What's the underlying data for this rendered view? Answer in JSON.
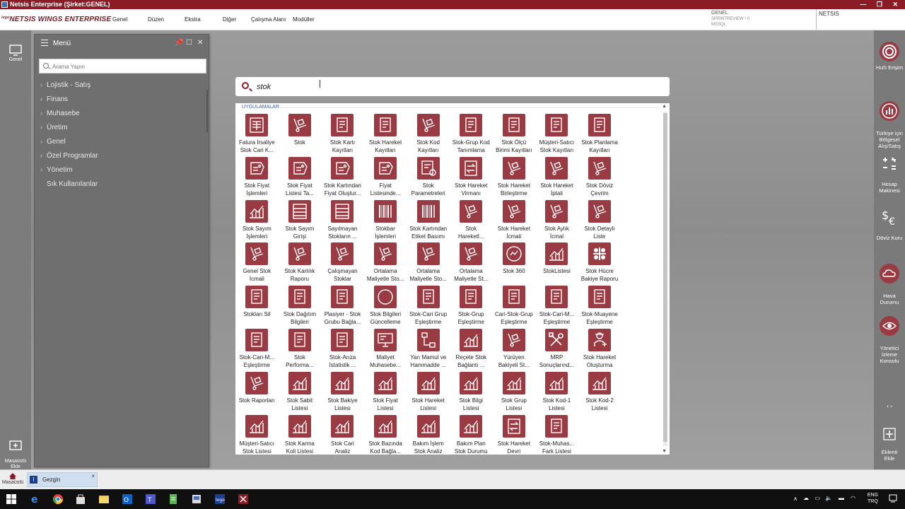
{
  "titlebar": {
    "title": "Netsis Enterprise (Şirket:GENEL)",
    "controls": "— ❐ ✕"
  },
  "header": {
    "logo_prefix": "logo",
    "logo": "NETSIS WINGS ENTERPRISE",
    "menu": [
      "Genel",
      "Düzen",
      "Ekstra",
      "Diğer",
      "Çalışma Alanı",
      "Modüller"
    ],
    "company": "GENEL",
    "server": "SPRINTREVIEW \\ 0",
    "db": "MSSQL",
    "user": "NETSIS"
  },
  "leftbar": {
    "genel": "Genel",
    "desktop_add": "Masaüstü\nEkle"
  },
  "menu_panel": {
    "title": "Menü",
    "search_placeholder": "Arama Yapın",
    "items": [
      "Lojistik - Satış",
      "Finans",
      "Muhasebe",
      "Üretim",
      "Genel",
      "Özel Programlar",
      "Yönetim"
    ],
    "favorites": "Sık Kullanılanlar"
  },
  "search": {
    "query": "stok",
    "section": "UYGULAMALAR"
  },
  "apps": [
    {
      "label": "Fatura İrsaliye\nStok Cari K...",
      "icon": "invoice-icon"
    },
    {
      "label": "Stok",
      "icon": "hand-truck-icon"
    },
    {
      "label": "Stok Kartı\nKayıtları",
      "icon": "document-icon"
    },
    {
      "label": "Stok Hareket\nKayıtları",
      "icon": "document-icon"
    },
    {
      "label": "Stok Kod\nKayıtları",
      "icon": "hand-truck-icon"
    },
    {
      "label": "Stok-Grup Kod\nTanımlama",
      "icon": "document-icon"
    },
    {
      "label": "Stok Ölçü\nBirimi Kayıtları",
      "icon": "document-icon"
    },
    {
      "label": "Müşteri-Satıcı\nStok Kayıtları",
      "icon": "document-icon"
    },
    {
      "label": "Stok Planlama\nKayıtları",
      "icon": "document-icon"
    },
    {
      "label": "Stok Fiyat\nİşlemleri",
      "icon": "price-tag-icon"
    },
    {
      "label": "Stok Fiyat\nListesi Ta...",
      "icon": "price-tag-icon"
    },
    {
      "label": "Stok Kartından\nFiyat Oluştur...",
      "icon": "price-tag-icon"
    },
    {
      "label": "Fiyat\nListesinde...",
      "icon": "price-tag-icon"
    },
    {
      "label": "Stok\nParametreleri",
      "icon": "settings-document-icon"
    },
    {
      "label": "Stok Hareket\nVirmanı",
      "icon": "transfer-icon"
    },
    {
      "label": "Stok Hareket\nBirleştirme",
      "icon": "hand-truck-icon"
    },
    {
      "label": "Stok Hareket\nİptali",
      "icon": "hand-truck-icon"
    },
    {
      "label": "Stok Döviz\nÇevrim",
      "icon": "hand-truck-icon"
    },
    {
      "label": "Stok Sayım\nİşlemleri",
      "icon": "chart-icon"
    },
    {
      "label": "Stok Sayım\nGirişi",
      "icon": "abacus-icon"
    },
    {
      "label": "Sayılmayan\nStokların ...",
      "icon": "abacus-icon"
    },
    {
      "label": "Stokbar\nİşlemleri",
      "icon": "barcode-icon"
    },
    {
      "label": "Stok Kartından\nEtiket Basımı",
      "icon": "barcode-icon"
    },
    {
      "label": "Stok\nHareketl...",
      "icon": "hand-truck-icon"
    },
    {
      "label": "Stok Hareket\nİcmali",
      "icon": "hand-truck-icon"
    },
    {
      "label": "Stok Aylık\nİcmal",
      "icon": "hand-truck-icon"
    },
    {
      "label": "Stok Detaylı\nListe",
      "icon": "hand-truck-icon"
    },
    {
      "label": "Genel Stok\nİcmali",
      "icon": "hand-truck-icon"
    },
    {
      "label": "Stok Karlılık\nRaporu",
      "icon": "hand-truck-icon"
    },
    {
      "label": "Çalışmayan\nStoklar",
      "icon": "hand-truck-icon"
    },
    {
      "label": "Ortalama\nMaliyetle Sto...",
      "icon": "hand-truck-icon"
    },
    {
      "label": "Ortalama\nMaliyetle Sto...",
      "icon": "hand-truck-icon"
    },
    {
      "label": "Ortalama\nMaliyetle St...",
      "icon": "hand-truck-icon"
    },
    {
      "label": "Stok 360",
      "icon": "gauge-icon"
    },
    {
      "label": "StokListesi",
      "icon": "chart-icon"
    },
    {
      "label": "Stok Hücre\nBakiye Raporu",
      "icon": "grid-icon"
    },
    {
      "label": "Stokları Sil",
      "icon": "document-icon"
    },
    {
      "label": "Stok Dağıtım\nBilgileri",
      "icon": "document-icon"
    },
    {
      "label": "Plasiyer - Stok\nGrubu Bağla...",
      "icon": "document-icon"
    },
    {
      "label": "Stok Bilgileri\nGüncelleme",
      "icon": "circle-icon"
    },
    {
      "label": "Stok-Cari Grup\nEşleştirme",
      "icon": "document-icon"
    },
    {
      "label": "Stok-Grup\nEşleştirme",
      "icon": "document-icon"
    },
    {
      "label": "Cari-Stok-Grup\nEşleştirme",
      "icon": "document-icon"
    },
    {
      "label": "Stok-Cari-M...\nEşleştirme",
      "icon": "document-icon"
    },
    {
      "label": "Stok-Muayene\nEşleştirme",
      "icon": "document-icon"
    },
    {
      "label": "Stok-Cari-M...\nEşleştirme",
      "icon": "document-icon"
    },
    {
      "label": "Stok\nPerforma...",
      "icon": "document-icon"
    },
    {
      "label": "Stok-Arıza\nİstatistik ...",
      "icon": "document-icon"
    },
    {
      "label": "Maliyet\nMuhasebe...",
      "icon": "monitor-icon"
    },
    {
      "label": "Yarı Mamul ve\nHammadde ...",
      "icon": "flow-icon"
    },
    {
      "label": "Reçete Stok\nBağlantı ...",
      "icon": "chart-icon"
    },
    {
      "label": "Yürüyen\nBakiyeli St...",
      "icon": "hand-truck-icon"
    },
    {
      "label": "MRP\nSonuçlarınd...",
      "icon": "tools-icon"
    },
    {
      "label": "Stok Hareket\nOluşturma",
      "icon": "worker-icon"
    },
    {
      "label": "Stok Raporları",
      "icon": "hand-truck-icon"
    },
    {
      "label": "Stok Sabit\nListesi",
      "icon": "chart-icon"
    },
    {
      "label": "Stok Bakiye\nListesi",
      "icon": "chart-icon"
    },
    {
      "label": "Stok Fiyat\nListesi",
      "icon": "chart-icon"
    },
    {
      "label": "Stok Hareket\nListesi",
      "icon": "chart-icon"
    },
    {
      "label": "Stok Bilgi\nListesi",
      "icon": "chart-icon"
    },
    {
      "label": "Stok Grup\nListesi",
      "icon": "chart-icon"
    },
    {
      "label": "Stok Kod-1\nListesi",
      "icon": "chart-icon"
    },
    {
      "label": "Stok Kod-2\nListesi",
      "icon": "chart-icon"
    },
    {
      "label": "Müşteri-Satıcı\nStok Listesi",
      "icon": "chart-icon"
    },
    {
      "label": "Stok Karma\nKoli Listesi",
      "icon": "chart-icon"
    },
    {
      "label": "Stok Cari\nAnaliz",
      "icon": "chart-icon"
    },
    {
      "label": "Stok Bazında\nKod Bağla...",
      "icon": "chart-icon"
    },
    {
      "label": "Bakım İşlem\nStok Analiz",
      "icon": "chart-icon"
    },
    {
      "label": "Bakım Plan\nStok Durumu",
      "icon": "chart-icon"
    },
    {
      "label": "Stok Hareket\nDevri",
      "icon": "transfer-icon"
    },
    {
      "label": "Stok-Muhas...\nFark Listesi",
      "icon": "document-icon"
    }
  ],
  "rightbar": {
    "quick": "Hızlı Erişim",
    "turkey": "Türkiye için\nBölgesel\nAlış/Satış",
    "calc": "Hesap\nMakinesi",
    "fx": "Döviz Kuru",
    "weather": "Hava\nDurumu",
    "monitor": "Yönetici\nİzleme\nKonsolu",
    "addon": "Eklenti\nEkle",
    "pager": "‹ ›"
  },
  "bottombar": {
    "desktop": "Masaüstü",
    "tab": "Gezgin",
    "tab_icon": "I"
  },
  "tray": {
    "lang": "ENG",
    "locale": "TRQ"
  },
  "colors": {
    "brand": "#8b1c26",
    "tile": "#9a3a42"
  }
}
